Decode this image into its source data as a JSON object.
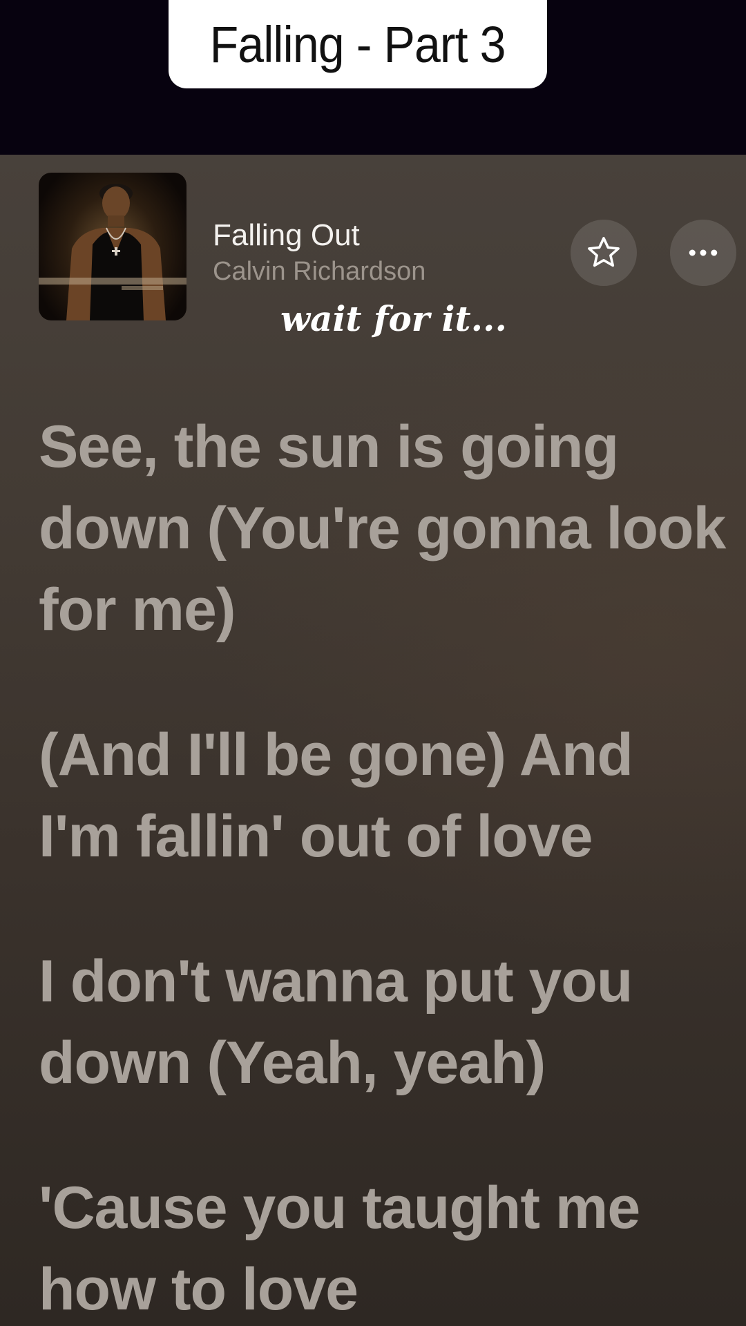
{
  "overlay": {
    "title": "Falling - Part 3",
    "caption": "wait for it..."
  },
  "now_playing": {
    "song_title": "Falling Out",
    "artist": "Calvin Richardson",
    "album_art_icon": "album-art",
    "favorite_icon": "star-icon",
    "more_icon": "more-icon"
  },
  "lyrics": [
    {
      "text": "See, the sun is going down (You're gonna look for me)"
    },
    {
      "text": "(And I'll be gone) And I'm fallin' out of love"
    },
    {
      "text": "I don't wanna put you down (Yeah, yeah)"
    },
    {
      "text": "'Cause you taught me how to love"
    }
  ],
  "colors": {
    "top_band": "#07020f",
    "lyric_text": "#a8a19a",
    "artist_text": "#9c948c",
    "title_text": "#f4f2ef"
  }
}
